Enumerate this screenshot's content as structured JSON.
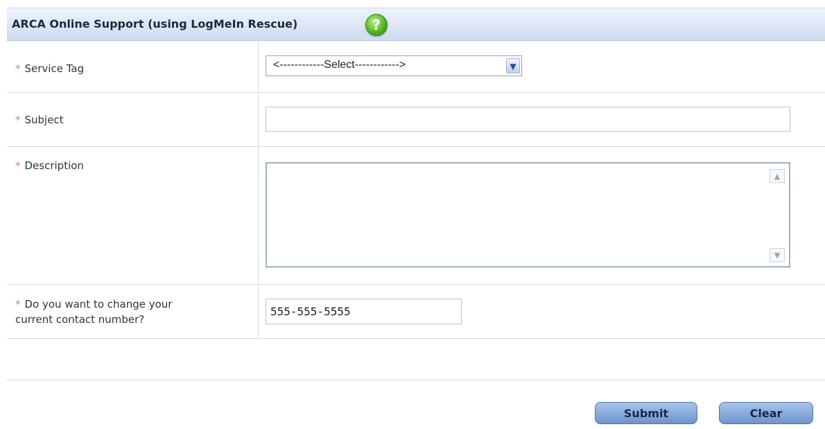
{
  "header": {
    "title": "ARCA Online Support (using LogMeIn Rescue)",
    "help_glyph": "?"
  },
  "form": {
    "required_marker": "*",
    "service_tag": {
      "label": "Service Tag",
      "selected": "<------------Select------------>"
    },
    "subject": {
      "label": "Subject",
      "value": ""
    },
    "description": {
      "label": "Description",
      "value": ""
    },
    "contact": {
      "label_line1": "Do you want to change your",
      "label_line2": "current contact number?",
      "value": "555-555-5555"
    }
  },
  "buttons": {
    "submit": "Submit",
    "clear": "Clear"
  },
  "icons": {
    "help": "help-question-icon",
    "dropdown": "chevron-down-icon"
  },
  "colors": {
    "header_top": "#eef4fc",
    "header_bottom": "#cddbef",
    "required": "#e07c6c",
    "button": "#6e94cc"
  }
}
